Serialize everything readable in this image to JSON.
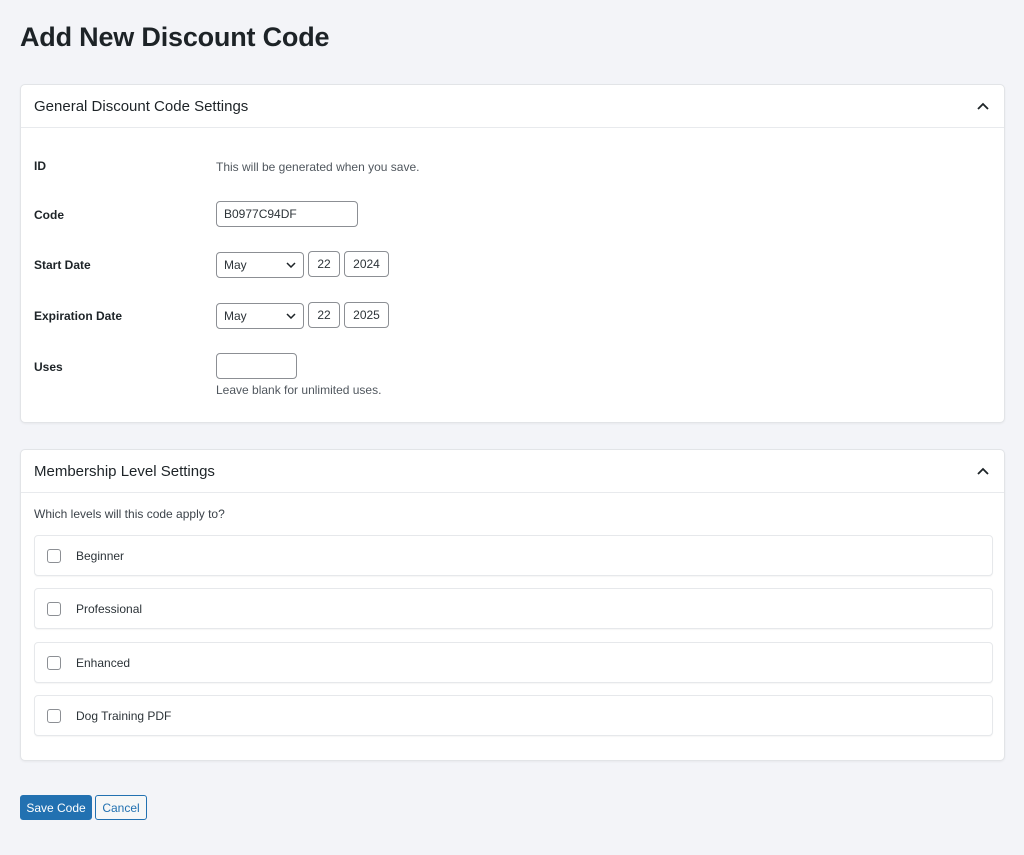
{
  "page": {
    "title": "Add New Discount Code"
  },
  "general": {
    "title": "General Discount Code Settings",
    "id_label": "ID",
    "id_text": "This will be generated when you save.",
    "code_label": "Code",
    "code_value": "B0977C94DF",
    "start_label": "Start Date",
    "start_month": "May",
    "start_day": "22",
    "start_year": "2024",
    "exp_label": "Expiration Date",
    "exp_month": "May",
    "exp_day": "22",
    "exp_year": "2025",
    "uses_label": "Uses",
    "uses_value": "",
    "uses_help": "Leave blank for unlimited uses."
  },
  "membership": {
    "title": "Membership Level Settings",
    "question": "Which levels will this code apply to?",
    "levels": [
      {
        "label": "Beginner",
        "checked": false
      },
      {
        "label": "Professional",
        "checked": false
      },
      {
        "label": "Enhanced",
        "checked": false
      },
      {
        "label": "Dog Training PDF",
        "checked": false
      }
    ]
  },
  "actions": {
    "save": "Save Code",
    "cancel": "Cancel"
  },
  "colors": {
    "primary": "#2271b1",
    "background": "#f3f4f8",
    "panel": "#ffffff"
  }
}
